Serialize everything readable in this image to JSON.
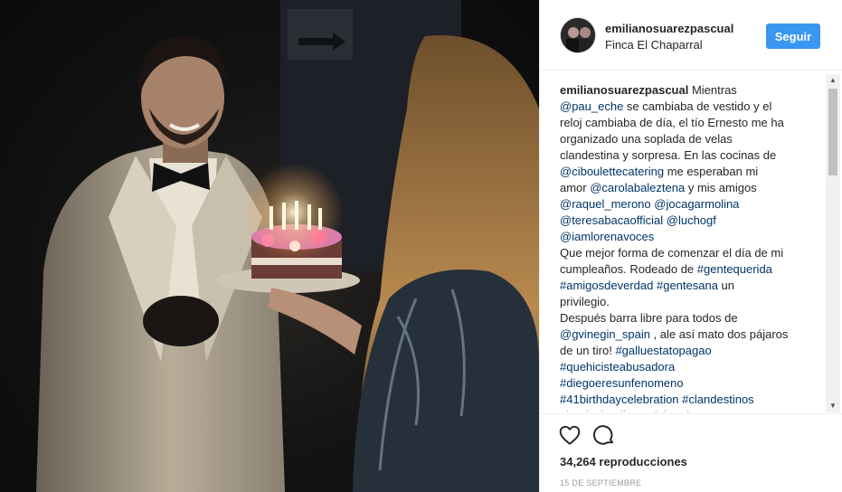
{
  "post": {
    "username": "emilianosuarezpascual",
    "location": "Finca El Chaparral",
    "follow_label": "Seguir",
    "views_count": "34,264",
    "views_label": "reproducciones",
    "date": "15 DE SEPTIEMBRE"
  },
  "caption": {
    "author": "emilianosuarezpascual",
    "lines": [
      [
        {
          "t": "emilianosuarezpascual",
          "c": "author"
        },
        {
          "t": " Mientras",
          "c": ""
        }
      ],
      [
        {
          "t": "@pau_eche",
          "c": "lk"
        },
        {
          "t": " se cambiaba de vestido y el",
          "c": ""
        }
      ],
      [
        {
          "t": "reloj cambiaba de día, el tío Ernesto me ha",
          "c": ""
        }
      ],
      [
        {
          "t": "organizado una soplada de velas",
          "c": ""
        }
      ],
      [
        {
          "t": "clandestina y sorpresa. En las cocinas de",
          "c": ""
        }
      ],
      [
        {
          "t": "@ciboulettecatering",
          "c": "lk"
        },
        {
          "t": " me esperaban mi",
          "c": ""
        }
      ],
      [
        {
          "t": "amor ",
          "c": ""
        },
        {
          "t": "@carolabaleztena",
          "c": "lk"
        },
        {
          "t": " y mis amigos",
          "c": ""
        }
      ],
      [
        {
          "t": "@raquel_merono",
          "c": "lk"
        },
        {
          "t": " ",
          "c": ""
        },
        {
          "t": "@jocagarmolina",
          "c": "lk"
        }
      ],
      [
        {
          "t": "@teresabacaofficial",
          "c": "lk"
        },
        {
          "t": " ",
          "c": ""
        },
        {
          "t": "@luchogf",
          "c": "lk"
        }
      ],
      [
        {
          "t": "@iamlorenavoces",
          "c": "lk"
        }
      ],
      [
        {
          "t": "Que mejor forma de comenzar el día de mi",
          "c": ""
        }
      ],
      [
        {
          "t": "cumpleaños. Rodeado de ",
          "c": ""
        },
        {
          "t": "#gentequerida",
          "c": "lk"
        }
      ],
      [
        {
          "t": "#amigosdeverdad",
          "c": "lk"
        },
        {
          "t": " ",
          "c": ""
        },
        {
          "t": "#gentesana",
          "c": "lk"
        },
        {
          "t": " un",
          "c": ""
        }
      ],
      [
        {
          "t": "privilegio.",
          "c": ""
        }
      ],
      [
        {
          "t": "Después barra libre para todos de",
          "c": ""
        }
      ],
      [
        {
          "t": "@gvinegin_spain",
          "c": "lk"
        },
        {
          "t": " , ale así mato dos pájaros",
          "c": ""
        }
      ],
      [
        {
          "t": "de un tiro! ",
          "c": ""
        },
        {
          "t": "#galluestatopagao",
          "c": "lk"
        }
      ],
      [
        {
          "t": "#quehicisteabusadora",
          "c": "lk"
        }
      ],
      [
        {
          "t": "#diegoeresunfenomeno",
          "c": "lk"
        }
      ],
      [
        {
          "t": "#41birthdaycelebration",
          "c": "lk"
        },
        {
          "t": " ",
          "c": ""
        },
        {
          "t": "#clandestinos",
          "c": "lk"
        }
      ],
      [
        {
          "t": "#huelvalandia",
          "c": "lk"
        },
        {
          "t": " ",
          "c": ""
        },
        {
          "t": "#celebracion",
          "c": "lk"
        }
      ]
    ]
  },
  "icons": {
    "like": "heart-outline-icon",
    "comment": "comment-bubble-icon",
    "scroll_up": "triangle-up",
    "scroll_down": "triangle-down"
  },
  "colors": {
    "follow_button": "#3897f0",
    "link": "#003569",
    "text": "#262626",
    "muted": "#999999"
  }
}
